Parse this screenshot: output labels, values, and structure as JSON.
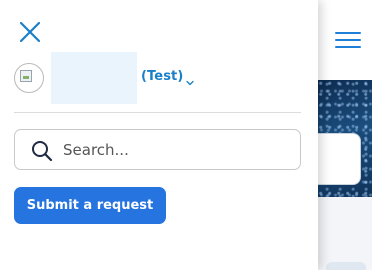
{
  "colors": {
    "accent": "#1a7fc8",
    "button_bg": "#2574e0",
    "button_text": "#ffffff",
    "hamburger": "#1e7fd8"
  },
  "drawer": {
    "close_icon": "close-icon",
    "user": {
      "avatar_icon": "broken-image-icon",
      "name": "(Test)",
      "dropdown_icon": "chevron-down-icon"
    },
    "search": {
      "icon": "search-icon",
      "placeholder": "Search...",
      "value": ""
    },
    "submit_label": "Submit a request"
  },
  "header": {
    "menu_icon": "hamburger-menu-icon"
  }
}
